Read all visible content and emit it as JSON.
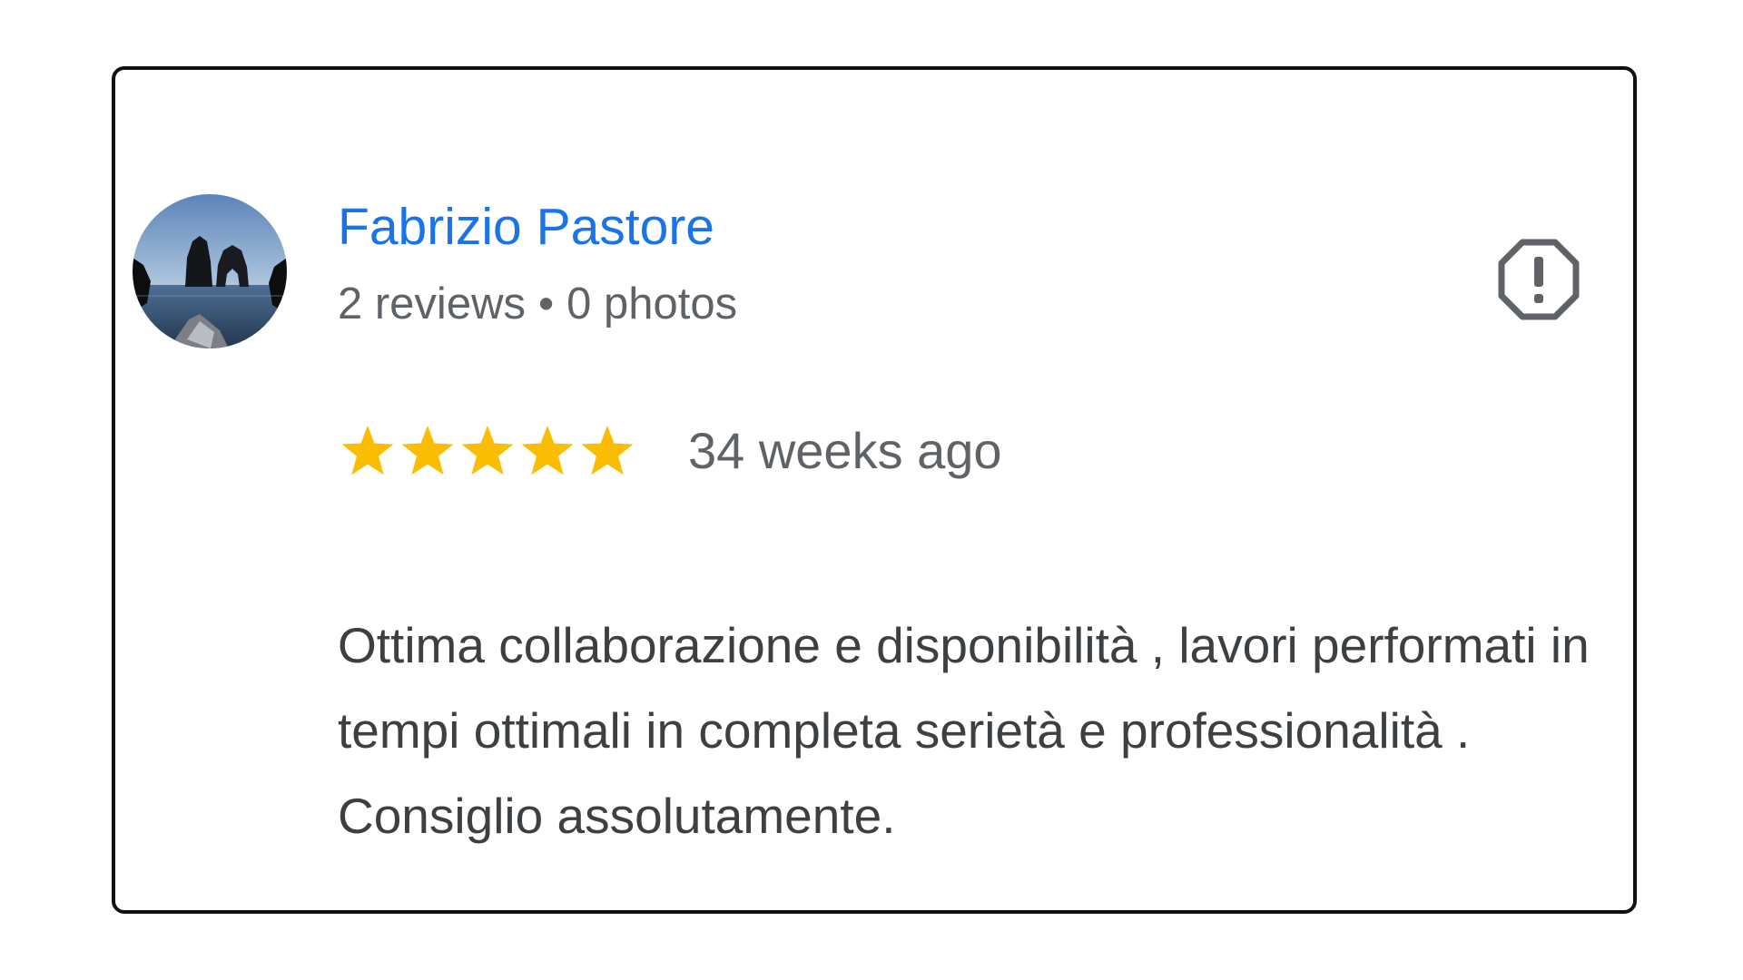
{
  "review": {
    "author": {
      "name": "Fabrizio Pastore",
      "reviews_count": "2 reviews",
      "separator": "•",
      "photos_count": "0 photos",
      "avatar_icon": "avatar-photo-sea-rocks"
    },
    "rating": {
      "value": 5,
      "max": 5,
      "star_color": "#fbbc04"
    },
    "date": "34 weeks ago",
    "text": "Ottima collaborazione e disponibilità , lavori performati in tempi ottimali in completa serietà e professionalità .\nConsiglio assolutamente.",
    "flag_icon": "report-flag-icon"
  },
  "colors": {
    "author_name": "#1a73e8",
    "secondary_text": "#5f6368",
    "body_text": "#3c4043",
    "card_border": "#111111"
  }
}
